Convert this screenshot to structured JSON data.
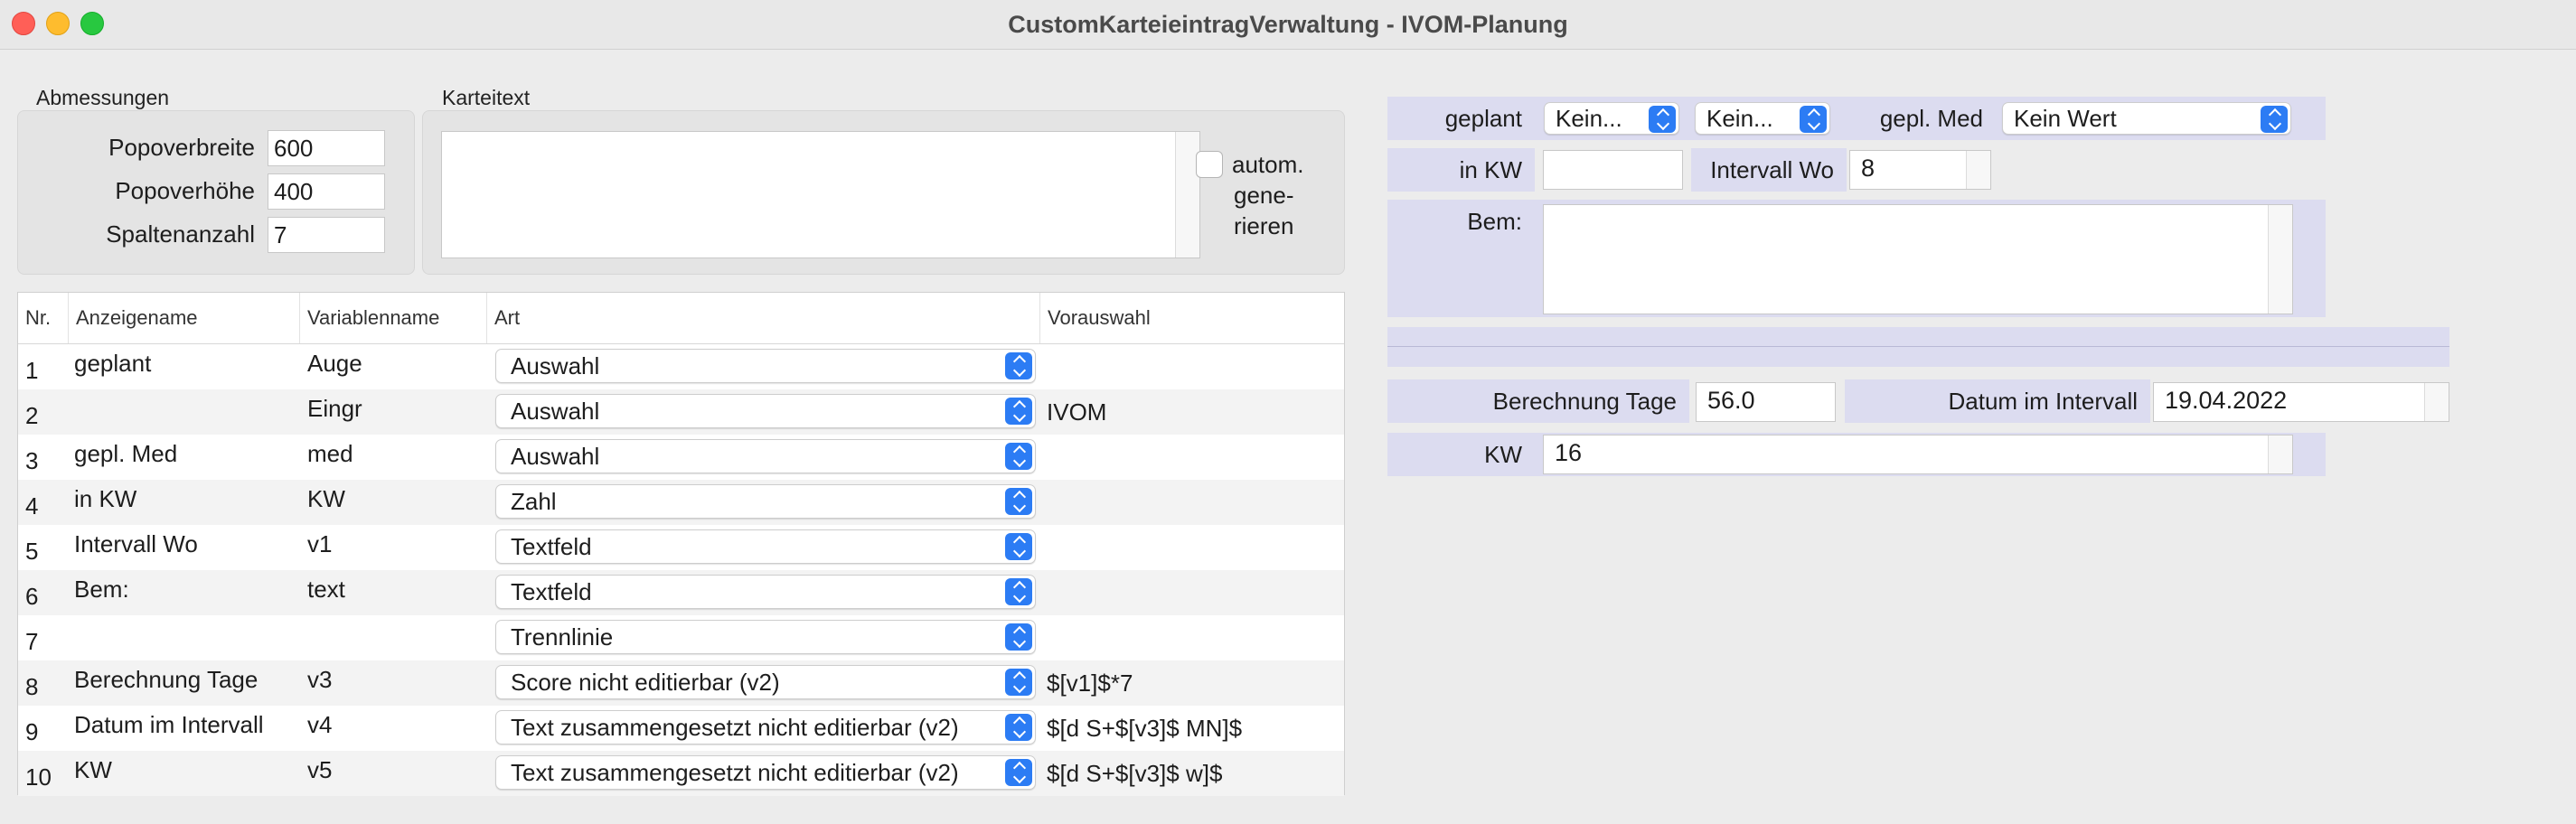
{
  "window": {
    "title": "CustomKarteieintragVerwaltung - IVOM-Planung"
  },
  "abmessungen": {
    "group_label": "Abmessungen",
    "popover_breite_label": "Popoverbreite",
    "popover_breite_value": "600",
    "popover_hoehe_label": "Popoverhöhe",
    "popover_hoehe_value": "400",
    "spaltenanzahl_label": "Spaltenanzahl",
    "spaltenanzahl_value": "7"
  },
  "karteitext": {
    "group_label": "Karteitext",
    "value": "",
    "autogen_label_1": "autom.",
    "autogen_label_2": "gene-",
    "autogen_label_3": "rieren"
  },
  "table": {
    "headers": [
      "Nr.",
      "Anzeigename",
      "Variablenname",
      "Art",
      "Vorauswahl"
    ],
    "rows": [
      {
        "nr": "1",
        "name": "geplant",
        "var": "Auge",
        "art": "Auswahl",
        "pre": ""
      },
      {
        "nr": "2",
        "name": "",
        "var": "Eingr",
        "art": "Auswahl",
        "pre": "IVOM"
      },
      {
        "nr": "3",
        "name": "gepl. Med",
        "var": "med",
        "art": "Auswahl",
        "pre": ""
      },
      {
        "nr": "4",
        "name": "in KW",
        "var": "KW",
        "art": "Zahl",
        "pre": ""
      },
      {
        "nr": "5",
        "name": "Intervall Wo",
        "var": "v1",
        "art": "Textfeld",
        "pre": ""
      },
      {
        "nr": "6",
        "name": "Bem:",
        "var": "text",
        "art": "Textfeld",
        "pre": ""
      },
      {
        "nr": "7",
        "name": "",
        "var": "",
        "art": "Trennlinie",
        "pre": ""
      },
      {
        "nr": "8",
        "name": "Berechnung Tage",
        "var": "v3",
        "art": "Score nicht editierbar (v2)",
        "pre": "$[v1]$*7"
      },
      {
        "nr": "9",
        "name": "Datum im Intervall",
        "var": "v4",
        "art": "Text zusammengesetzt nicht editierbar (v2)",
        "pre": "$[d S+$[v3]$ MN]$"
      },
      {
        "nr": "10",
        "name": "KW",
        "var": "v5",
        "art": "Text zusammengesetzt nicht editierbar (v2)",
        "pre": "$[d S+$[v3]$ w]$"
      }
    ]
  },
  "preview": {
    "geplant_label": "geplant",
    "geplant_popup1": "Kein...",
    "geplant_popup2": "Kein...",
    "gepl_med_label": "gepl. Med",
    "gepl_med_value": "Kein Wert",
    "in_kw_label": "in KW",
    "in_kw_value": "",
    "intervall_label": "Intervall Wo",
    "intervall_value": "8",
    "bem_label": "Bem:",
    "bem_value": "",
    "berechnung_label": "Berechnung Tage",
    "berechnung_value": "56.0",
    "datum_label": "Datum im Intervall",
    "datum_value": "19.04.2022",
    "kw_label": "KW",
    "kw_value": "16"
  }
}
